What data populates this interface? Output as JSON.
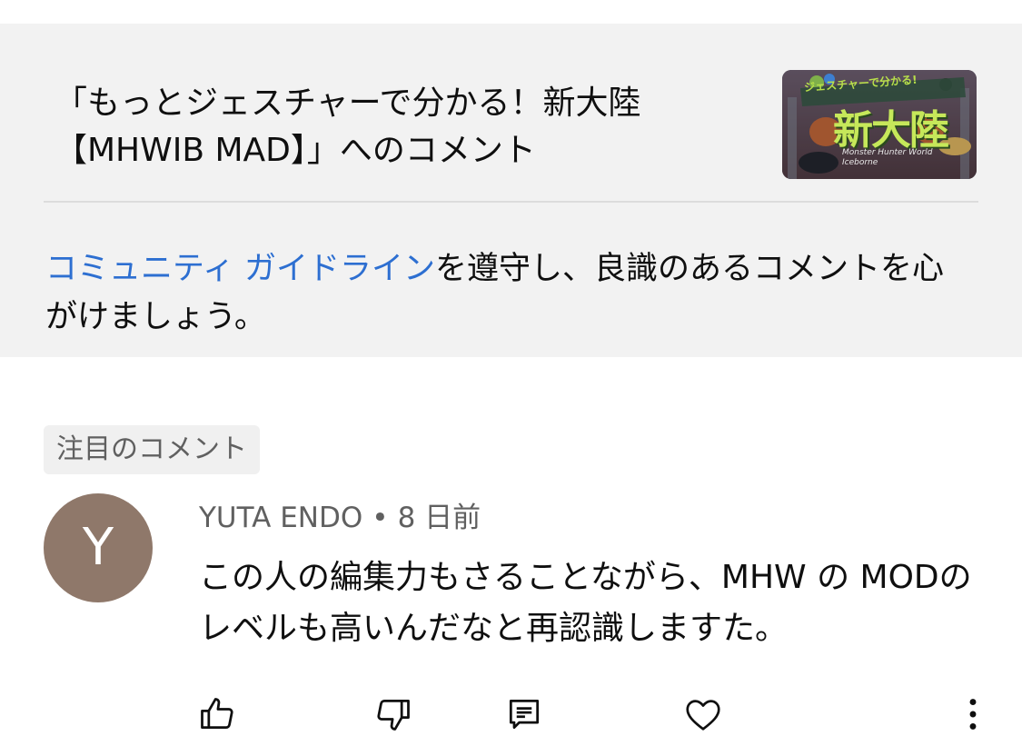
{
  "header": {
    "video_title": "「もっとジェスチャーで分かる！新大陸【MHWIB MAD】」へのコメント",
    "thumbnail": {
      "title_text": "新大陸",
      "top_text": "ジェスチャーで分かる!",
      "subtitle_text": "Monster Hunter World Iceborne"
    }
  },
  "guidelines": {
    "link_text": "コミュニティ ガイドライン",
    "rest_text": "を遵守し、良識のあるコメントを心がけましょう。"
  },
  "featured_label": "注目のコメント",
  "comment": {
    "avatar_letter": "Y",
    "author": "YUTA ENDO",
    "separator": "•",
    "time": "8 日前",
    "text": "この人の編集力もさることながら、MHW の MODのレベルも高いんだなと再認識しますた。"
  },
  "actions": {
    "icons": [
      "thumbs-up-icon",
      "thumbs-down-icon",
      "reply-icon",
      "heart-icon",
      "more-icon"
    ]
  },
  "colors": {
    "panel_bg": "#f2f2f2",
    "link": "#2d6fd1",
    "avatar_bg": "#8f786a",
    "secondary_text": "#606060"
  }
}
